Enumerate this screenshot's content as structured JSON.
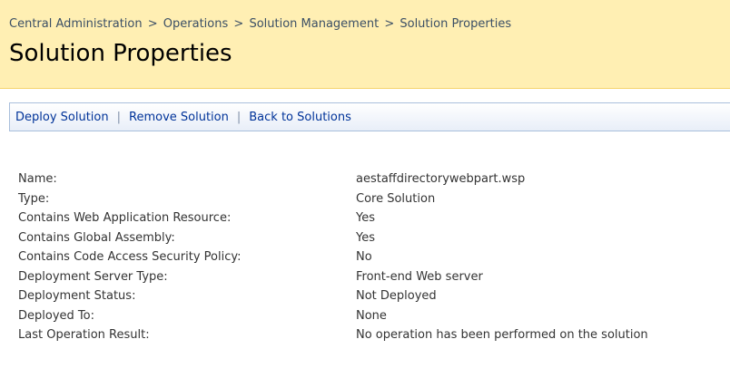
{
  "breadcrumb": {
    "items": [
      "Central Administration",
      "Operations",
      "Solution Management"
    ],
    "current": "Solution Properties",
    "separator": ">"
  },
  "page_title": "Solution Properties",
  "toolbar": {
    "deploy_label": "Deploy Solution",
    "remove_label": "Remove Solution",
    "back_label": "Back to Solutions",
    "separator": "|"
  },
  "properties": [
    {
      "label": "Name:",
      "value": "aestaffdirectorywebpart.wsp"
    },
    {
      "label": "Type:",
      "value": "Core Solution"
    },
    {
      "label": "Contains Web Application Resource:",
      "value": "Yes"
    },
    {
      "label": "Contains Global Assembly:",
      "value": "Yes"
    },
    {
      "label": "Contains Code Access Security Policy:",
      "value": "No"
    },
    {
      "label": "Deployment Server Type:",
      "value": "Front-end Web server"
    },
    {
      "label": "Deployment Status:",
      "value": "Not Deployed"
    },
    {
      "label": "Deployed To:",
      "value": "None"
    },
    {
      "label": "Last Operation Result:",
      "value": "No operation has been performed on the solution"
    }
  ],
  "colors": {
    "header_bg": "#ffefb3",
    "link": "#003399",
    "breadcrumb": "#3b4f65"
  }
}
